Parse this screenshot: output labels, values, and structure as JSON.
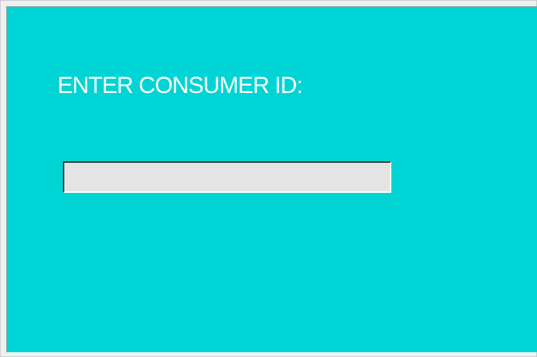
{
  "form": {
    "prompt_label": "ENTER CONSUMER ID:",
    "consumer_id_value": "",
    "consumer_id_placeholder": ""
  },
  "colors": {
    "panel_background": "#00d4d4",
    "label_text": "#ffffff",
    "input_background": "#e4e4e4"
  }
}
